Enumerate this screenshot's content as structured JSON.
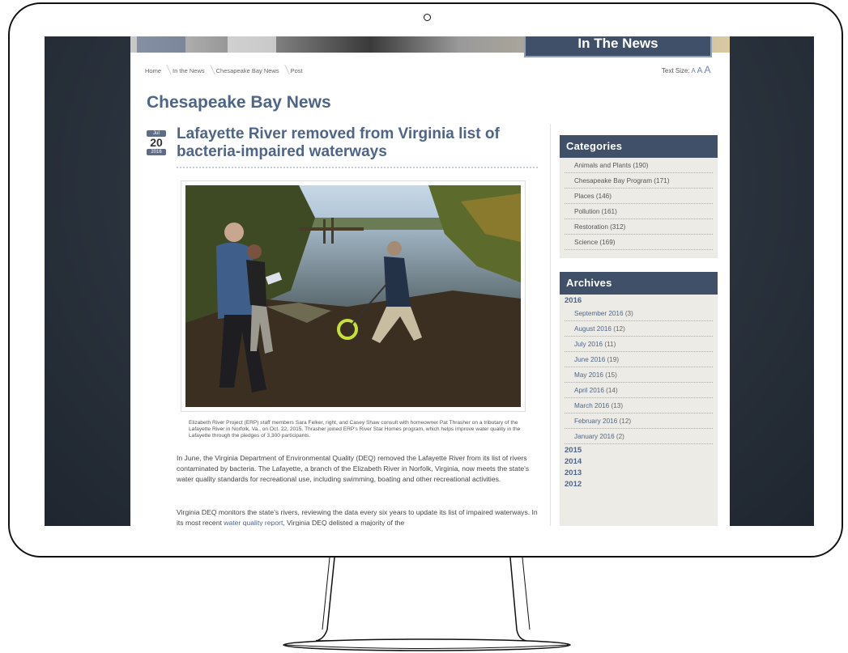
{
  "banner": {
    "title": "In The News"
  },
  "breadcrumb": [
    "Home",
    "In the News",
    "Chesapeake Bay News",
    "Post"
  ],
  "text_size": {
    "label": "Text Size:",
    "small": "A",
    "medium": "A",
    "large": "A"
  },
  "page_title": "Chesapeake Bay News",
  "post": {
    "date": {
      "month": "Jul",
      "day": "20",
      "year": "2016"
    },
    "title": "Lafayette River removed from Virginia list of bacteria-impaired waterways",
    "caption": "Elizabeth River Project (ERP) staff members Sara Felker, right, and Casey Shaw consult with homeowner Pat Thrasher on a tributary of the Lafayette River in Norfolk, Va., on Oct. 22, 2015. Thrasher joined ERP's River Star Homes program, which helps improve water quality in the Lafayette through the pledges of 3,300 participants.",
    "paragraph1": "In June, the Virginia Department of Environmental Quality (DEQ) removed the Lafayette River from its list of rivers contaminated by bacteria. The Lafayette, a branch of the Elizabeth River in Norfolk, Virginia, now meets the state's water quality standards for recreational use, including swimming, boating and other recreational activities.",
    "paragraph2_a": "Virginia DEQ monitors the state's rivers, reviewing the data every six years to update its list of impaired waterways. In its most recent ",
    "paragraph2_link": "water quality report",
    "paragraph2_b": ", Virginia DEQ delisted a majority of the"
  },
  "categories": {
    "heading": "Categories",
    "items": [
      "Animals and Plants (190)",
      "Chesapeake Bay Program (171)",
      "Places (146)",
      "Pollution (161)",
      "Restoration (312)",
      "Science (169)"
    ]
  },
  "archives": {
    "heading": "Archives",
    "year_2016": "2016",
    "months": [
      {
        "label": "September 2016",
        "count": "(3)"
      },
      {
        "label": "August 2016",
        "count": "(12)"
      },
      {
        "label": "July 2016",
        "count": "(11)"
      },
      {
        "label": "June 2016",
        "count": "(19)"
      },
      {
        "label": "May 2016",
        "count": "(15)"
      },
      {
        "label": "April 2016",
        "count": "(14)"
      },
      {
        "label": "March 2016",
        "count": "(13)"
      },
      {
        "label": "February 2016",
        "count": "(12)"
      },
      {
        "label": "January 2016",
        "count": "(2)"
      }
    ],
    "other_years": [
      "2015",
      "2014",
      "2013",
      "2012"
    ]
  },
  "colors": {
    "accent": "#4f6587",
    "widget_header": "#3f5068",
    "screen_bg": "#2a323d"
  }
}
